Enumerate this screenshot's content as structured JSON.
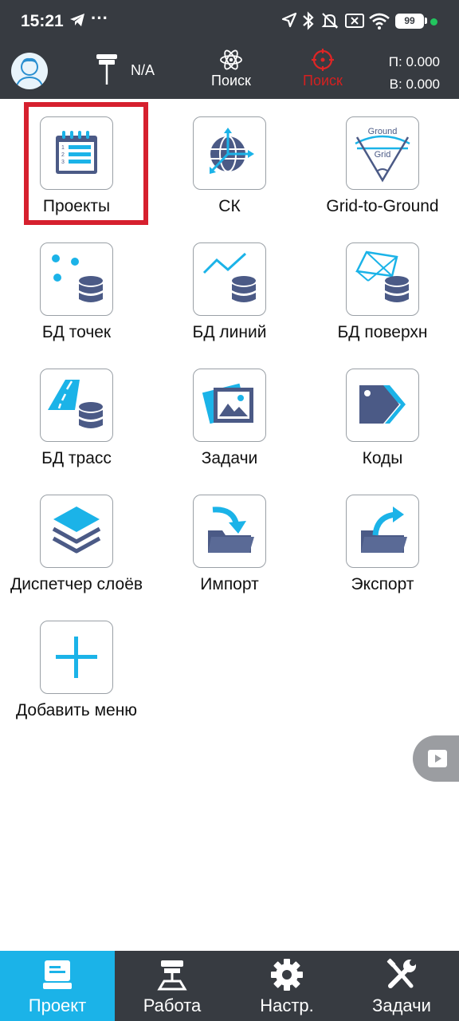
{
  "status_bar": {
    "time": "15:21",
    "battery": "99"
  },
  "header": {
    "antenna_status": "N/A",
    "search_label_1": "Поиск",
    "search_label_2": "Поиск",
    "coord_p": "П: 0.000",
    "coord_v": "В: 0.000"
  },
  "menu": {
    "projects": "Проекты",
    "cs": "СК",
    "grid_to_ground": "Grid-to-Ground",
    "points_db": "БД точек",
    "lines_db": "БД линий",
    "surface_db": "БД поверхн",
    "routes_db": "БД трасс",
    "tasks": "Задачи",
    "codes": "Коды",
    "layer_manager": "Диспетчер слоёв",
    "import": "Импорт",
    "export": "Экспорт",
    "add_menu": "Добавить меню",
    "ground_text": "Ground",
    "grid_text": "Grid",
    "list_nums": [
      "1",
      "2",
      "3"
    ]
  },
  "bottom_nav": {
    "project": "Проект",
    "work": "Работа",
    "settings": "Настр.",
    "tasks": "Задачи"
  },
  "colors": {
    "accent": "#1bb3e8",
    "dark": "#373b41",
    "highlight": "#d6202e",
    "icon_navy": "#4b5a86"
  }
}
